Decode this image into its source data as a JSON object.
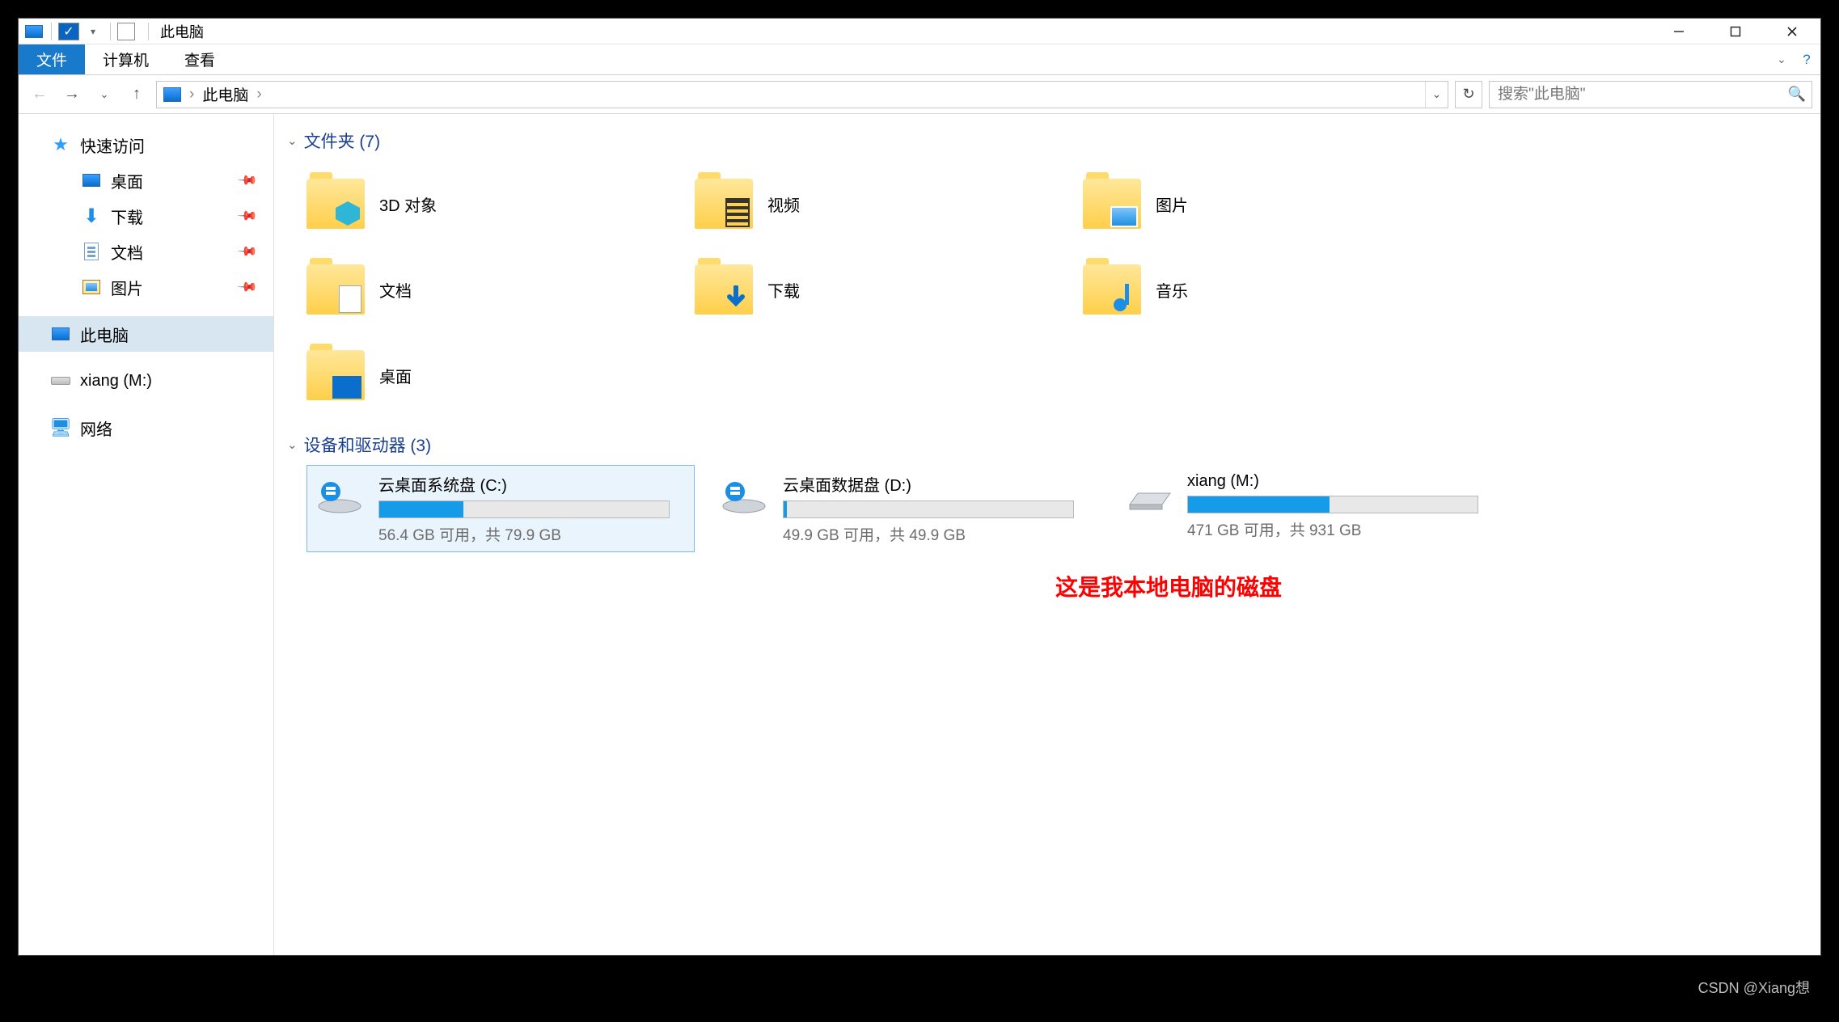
{
  "titlebar": {
    "title": "此电脑"
  },
  "ribbon": {
    "file": "文件",
    "computer": "计算机",
    "view": "查看"
  },
  "breadcrumb": {
    "root": "此电脑"
  },
  "search": {
    "placeholder": "搜索\"此电脑\""
  },
  "sidebar": {
    "quick_access": "快速访问",
    "items": [
      {
        "label": "桌面"
      },
      {
        "label": "下载"
      },
      {
        "label": "文档"
      },
      {
        "label": "图片"
      }
    ],
    "this_pc": "此电脑",
    "mapped_drive": "xiang (M:)",
    "network": "网络"
  },
  "sections": {
    "folders_header": "文件夹 (7)",
    "drives_header": "设备和驱动器 (3)"
  },
  "folders": [
    {
      "label": "3D 对象"
    },
    {
      "label": "视频"
    },
    {
      "label": "图片"
    },
    {
      "label": "文档"
    },
    {
      "label": "下载"
    },
    {
      "label": "音乐"
    },
    {
      "label": "桌面"
    }
  ],
  "drives": [
    {
      "name": "云桌面系统盘 (C:)",
      "stats": "56.4 GB 可用，共 79.9 GB",
      "fill_pct": 29
    },
    {
      "name": "云桌面数据盘 (D:)",
      "stats": "49.9 GB 可用，共 49.9 GB",
      "fill_pct": 1
    },
    {
      "name": "xiang (M:)",
      "stats": "471 GB 可用，共 931 GB",
      "fill_pct": 49
    }
  ],
  "annotation": "这是我本地电脑的磁盘",
  "watermark": "CSDN @Xiang想"
}
